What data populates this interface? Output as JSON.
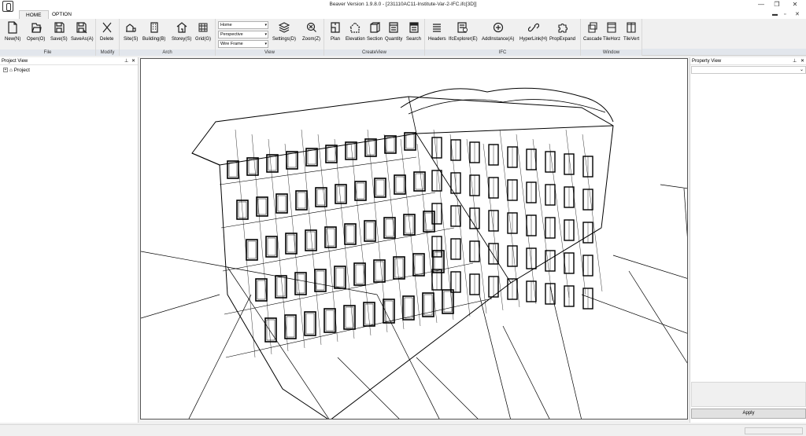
{
  "window": {
    "title": "Beaver Version 1.9.8.0 - [231110AC11-Institute-Var-2-IFC.ifc[3D]]",
    "minimize": "—",
    "restore": "❐",
    "close": "✕"
  },
  "tabs": [
    {
      "label": "HOME",
      "active": true
    },
    {
      "label": "OPTION",
      "active": false
    }
  ],
  "mdi_controls": {
    "minimize": "▬",
    "restore": "▫",
    "close": "✕"
  },
  "ribbon": {
    "file": {
      "label": "File",
      "buttons": [
        {
          "label": "New(N)",
          "icon": "new-document-icon"
        },
        {
          "label": "Open(O)",
          "icon": "open-folder-icon"
        },
        {
          "label": "Save(S)",
          "icon": "save-icon"
        },
        {
          "label": "SaveAs(A)",
          "icon": "save-as-icon"
        }
      ]
    },
    "modify": {
      "label": "Modify",
      "buttons": [
        {
          "label": "Delete",
          "icon": "delete-x-icon"
        }
      ]
    },
    "arch": {
      "label": "Arch",
      "buttons": [
        {
          "label": "Site(S)",
          "icon": "site-icon"
        },
        {
          "label": "Building(B)",
          "icon": "building-icon"
        },
        {
          "label": "Storey(S)",
          "icon": "storey-icon"
        },
        {
          "label": "Grid(G)",
          "icon": "grid-icon"
        }
      ]
    },
    "view": {
      "label": "View",
      "combos": [
        "Home",
        "Perspective",
        "Wire Frame"
      ],
      "buttons": [
        {
          "label": "Settings(D)",
          "icon": "layers-icon"
        },
        {
          "label": "Zoom(Z)",
          "icon": "zoom-icon"
        }
      ]
    },
    "create_view": {
      "label": "CreateView",
      "buttons": [
        {
          "label": "Plan",
          "icon": "plan-icon"
        },
        {
          "label": "Elevation",
          "icon": "elevation-icon"
        },
        {
          "label": "Section",
          "icon": "section-icon"
        },
        {
          "label": "Quantity",
          "icon": "quantity-icon"
        },
        {
          "label": "Search",
          "icon": "search-list-icon"
        }
      ]
    },
    "ifc": {
      "label": "IFC",
      "buttons": [
        {
          "label": "Headers",
          "icon": "headers-icon"
        },
        {
          "label": "IfcExplorer(E)",
          "icon": "ifc-explorer-icon"
        },
        {
          "label": "AddInstance(A)",
          "icon": "add-instance-icon"
        },
        {
          "label": "HyperLink(H)",
          "icon": "hyperlink-icon"
        },
        {
          "label": "PropExpand",
          "icon": "puzzle-icon"
        }
      ]
    },
    "window": {
      "label": "Window",
      "buttons": [
        {
          "label": "Cascade",
          "icon": "cascade-icon"
        },
        {
          "label": "TileHorz",
          "icon": "tile-horizontal-icon"
        },
        {
          "label": "TileVert",
          "icon": "tile-vertical-icon"
        }
      ]
    }
  },
  "project_view": {
    "title": "Project View",
    "pin": "📌",
    "close": "✕",
    "tree": [
      {
        "label": "Project",
        "expander": "+"
      }
    ]
  },
  "property_view": {
    "title": "Property View",
    "pin": "📌",
    "close": "✕",
    "apply": "Apply"
  }
}
